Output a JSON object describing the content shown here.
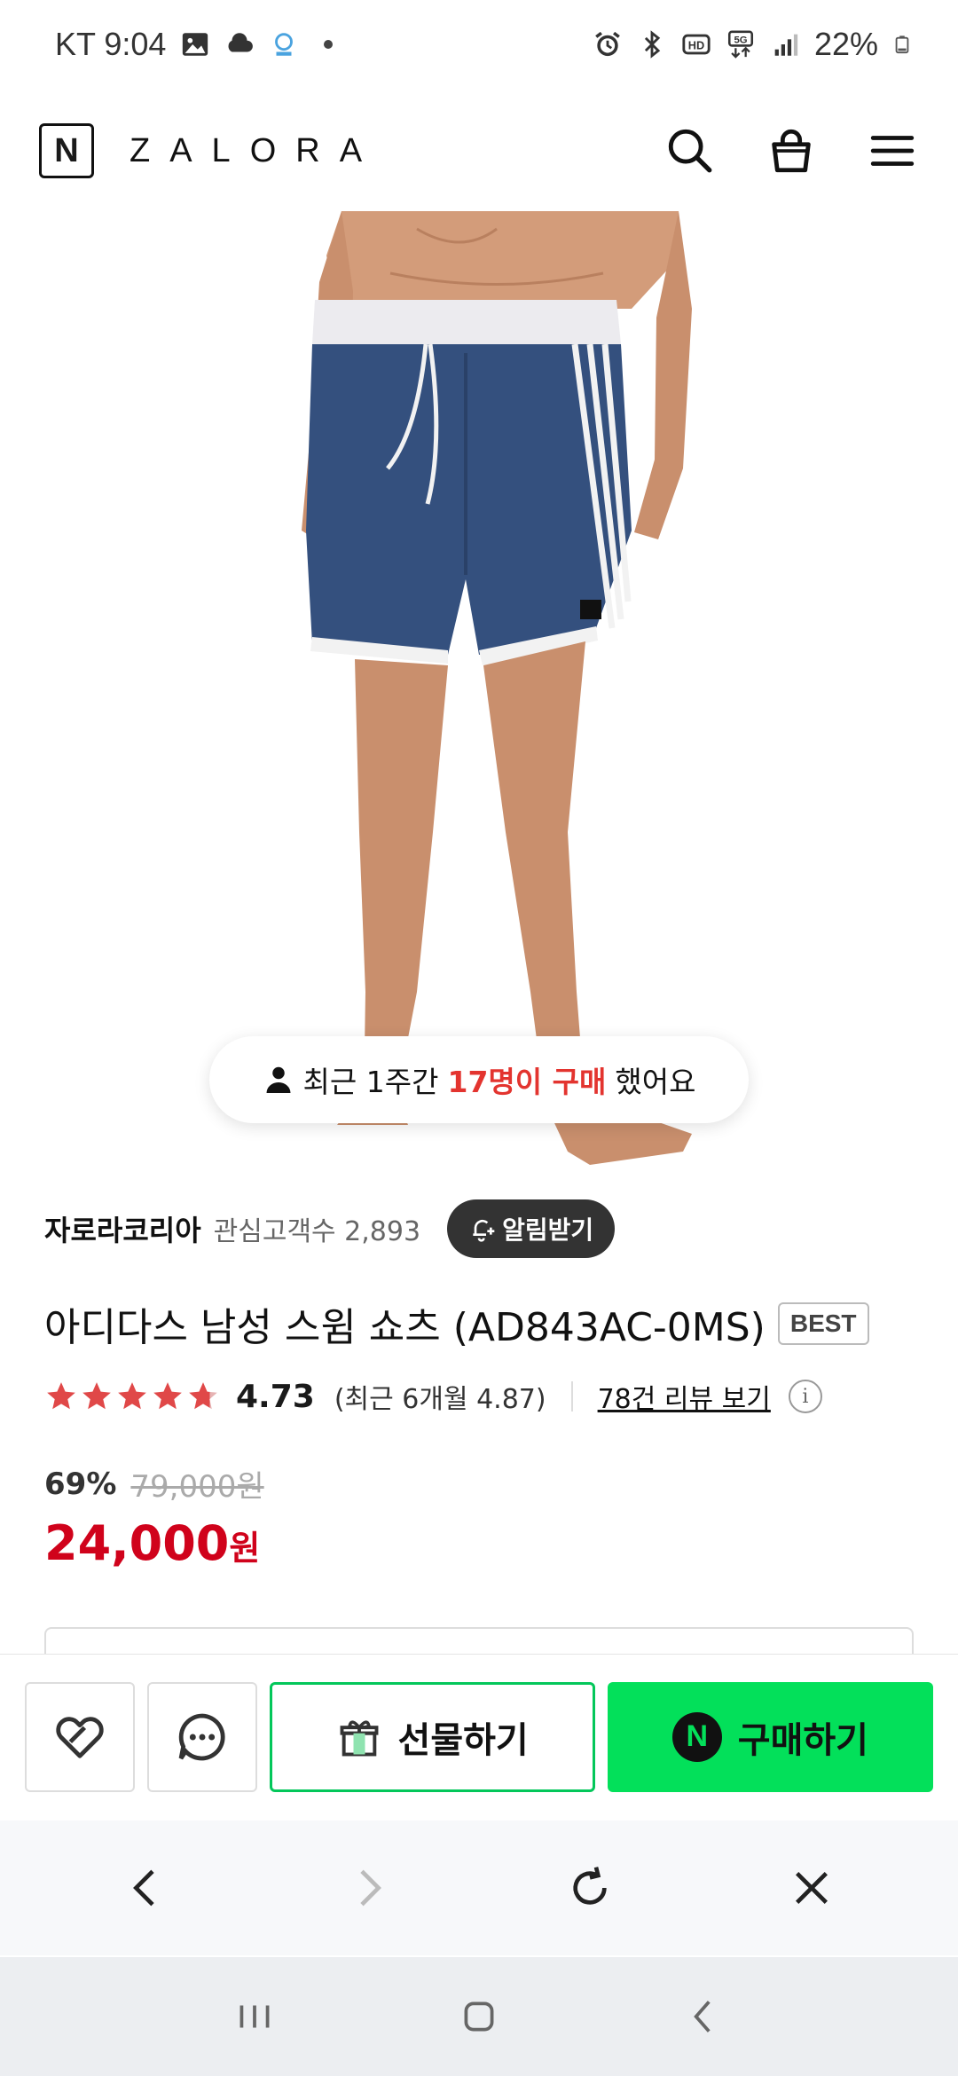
{
  "status_bar": {
    "carrier_time": "KT 9:04",
    "battery": "22%",
    "left_icons": [
      "gallery-icon",
      "cloud-icon",
      "app-notification-icon",
      "dot-icon"
    ],
    "right_icons": [
      "alarm-icon",
      "bluetooth-icon",
      "hd-icon",
      "5g-icon",
      "signal-icon",
      "battery-icon"
    ]
  },
  "header": {
    "logo_letter": "N",
    "brand": "ZALORA",
    "icons": [
      "search-icon",
      "shopping-bag-icon",
      "menu-icon"
    ]
  },
  "hero": {
    "buyers_prefix": "최근 1주간",
    "buyers_highlight": "17명이 구매",
    "buyers_suffix": "했어요"
  },
  "seller": {
    "name": "자로라코리아",
    "followers_label": "관심고객수 2,893",
    "notify_label": "알림받기"
  },
  "product": {
    "title": "아디다스 남성 스윔 쇼츠 (AD843AC-0MS)",
    "badge": "BEST",
    "rating": "4.73",
    "rating_value": 4.73,
    "rating_recent": "(최근 6개월 4.87)",
    "review_link": "78건 리뷰 보기",
    "discount": "69%",
    "original_price": "79,000원",
    "price": "24,000",
    "currency": "원"
  },
  "colors": {
    "accent_green": "#03e05a",
    "price_red": "#d0021b",
    "highlight_red": "#e3342f",
    "star_red": "#e04848",
    "short_navy": "#34507e"
  },
  "action_bar": {
    "wishlist_icon": "heart-icon",
    "talk_icon": "chat-icon",
    "gift_label": "선물하기",
    "buy_label": "구매하기",
    "buy_logo": "N"
  },
  "browser_nav": [
    "back-icon",
    "forward-icon",
    "refresh-icon",
    "close-icon"
  ],
  "system_nav": [
    "recents-icon",
    "home-icon",
    "back-icon"
  ]
}
